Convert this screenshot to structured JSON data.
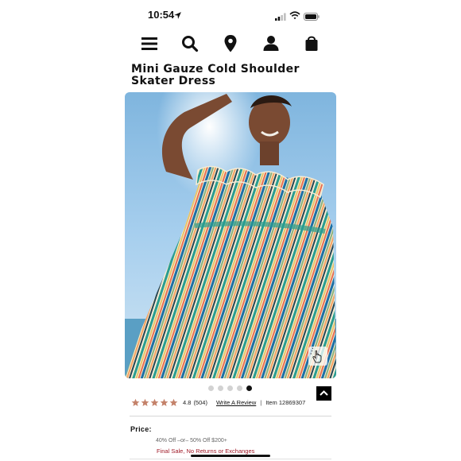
{
  "status_bar": {
    "time": "10:54",
    "location_icon": "location-arrow-icon",
    "signal_icon": "cellular-signal-icon",
    "wifi_icon": "wifi-icon",
    "battery_icon": "battery-icon"
  },
  "nav": {
    "items": [
      {
        "name": "menu",
        "icon": "hamburger-menu-icon"
      },
      {
        "name": "search",
        "icon": "search-icon"
      },
      {
        "name": "store-locator",
        "icon": "map-pin-icon"
      },
      {
        "name": "account",
        "icon": "user-icon"
      },
      {
        "name": "bag",
        "icon": "shopping-bag-icon"
      }
    ]
  },
  "product": {
    "title": "Mini Gauze Cold Shoulder Skater Dress",
    "image_count": 5,
    "active_image_index": 4,
    "rating": {
      "stars": 5,
      "score": "4.8",
      "count": "(504)",
      "write_review": "Write A Review",
      "separator": "|",
      "item_number": "Item 12869307"
    },
    "price_label": "Price:",
    "promo": "40% Off –or– 50% Off $200+",
    "final_sale": "Final Sale, No Returns or Exchanges"
  },
  "colors": {
    "star": "#c4826a",
    "final_sale": "#a01a28",
    "sky": "#8fbfe0"
  }
}
